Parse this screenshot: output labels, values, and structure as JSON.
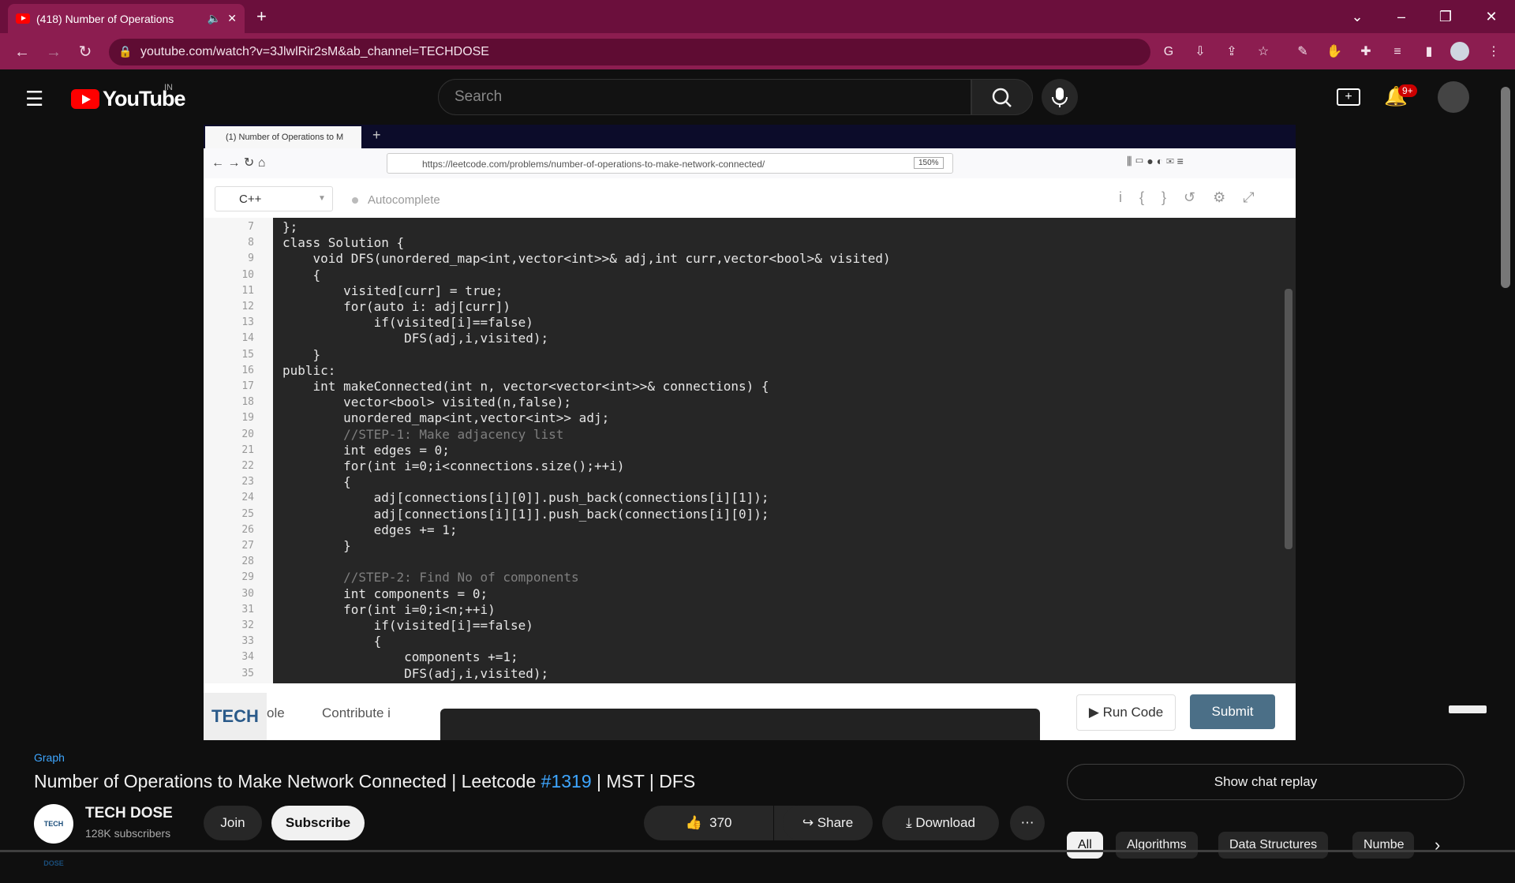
{
  "browser": {
    "tab_title": "(418) Number of Operations",
    "url": "youtube.com/watch?v=3JlwlRir2sM&ab_channel=TECHDOSE"
  },
  "youtube_header": {
    "logo_text": "YouTube",
    "country_code": "IN",
    "search_placeholder": "Search",
    "notification_count": "9+"
  },
  "video_frame": {
    "tab_title": "(1) Number of Operations to M",
    "url": "https://leetcode.com/problems/number-of-operations-to-make-network-connected/",
    "zoom": "150%",
    "language": "C++",
    "autocomplete_label": "Autocomplete",
    "footer_left": "ole",
    "contribute_label": "Contribute i",
    "run_label": "Run Code",
    "submit_label": "Submit",
    "logo_text": "TECH",
    "code_lines": [
      {
        "n": "7",
        "text": "};"
      },
      {
        "n": "8",
        "text": "class Solution {"
      },
      {
        "n": "9",
        "text": "    void DFS(unordered_map<int,vector<int>>& adj,int curr,vector<bool>& visited)"
      },
      {
        "n": "10",
        "text": "    {"
      },
      {
        "n": "11",
        "text": "        visited[curr] = true;"
      },
      {
        "n": "12",
        "text": "        for(auto i: adj[curr])"
      },
      {
        "n": "13",
        "text": "            if(visited[i]==false)"
      },
      {
        "n": "14",
        "text": "                DFS(adj,i,visited);"
      },
      {
        "n": "15",
        "text": "    }"
      },
      {
        "n": "16",
        "text": "public:"
      },
      {
        "n": "17",
        "text": "    int makeConnected(int n, vector<vector<int>>& connections) {"
      },
      {
        "n": "18",
        "text": "        vector<bool> visited(n,false);"
      },
      {
        "n": "19",
        "text": "        unordered_map<int,vector<int>> adj;"
      },
      {
        "n": "20",
        "text": "        //STEP-1: Make adjacency list"
      },
      {
        "n": "21",
        "text": "        int edges = 0;"
      },
      {
        "n": "22",
        "text": "        for(int i=0;i<connections.size();++i)"
      },
      {
        "n": "23",
        "text": "        {"
      },
      {
        "n": "24",
        "text": "            adj[connections[i][0]].push_back(connections[i][1]);"
      },
      {
        "n": "25",
        "text": "            adj[connections[i][1]].push_back(connections[i][0]);"
      },
      {
        "n": "26",
        "text": "            edges += 1;"
      },
      {
        "n": "27",
        "text": "        }"
      },
      {
        "n": "28",
        "text": ""
      },
      {
        "n": "29",
        "text": "        //STEP-2: Find No of components"
      },
      {
        "n": "30",
        "text": "        int components = 0;"
      },
      {
        "n": "31",
        "text": "        for(int i=0;i<n;++i)"
      },
      {
        "n": "32",
        "text": "            if(visited[i]==false)"
      },
      {
        "n": "33",
        "text": "            {"
      },
      {
        "n": "34",
        "text": "                components +=1;"
      },
      {
        "n": "35",
        "text": "                DFS(adj,i,visited);"
      }
    ]
  },
  "video_info": {
    "hashtag": "Graph",
    "title_prefix": "Number of Operations to Make Network Connected | Leetcode ",
    "title_link": "#1319",
    "title_suffix": " | MST | DFS",
    "channel_name": "TECH DOSE",
    "channel_avatar_text": "TECH DOSE",
    "subscribers": "128K subscribers",
    "join_label": "Join",
    "subscribe_label": "Subscribe",
    "like_count": "370",
    "share_label": "Share",
    "download_label": "Download"
  },
  "sidebar": {
    "chat_replay_label": "Show chat replay",
    "chips": [
      "All",
      "Algorithms",
      "Data Structures",
      "Numbe"
    ]
  },
  "colors": {
    "tab_strip": "#6b0f3c",
    "address_bar": "#8c1d50",
    "youtube_bg": "#0f0f0f",
    "link_blue": "#3ea6ff",
    "submit_button": "#4b6f87"
  }
}
